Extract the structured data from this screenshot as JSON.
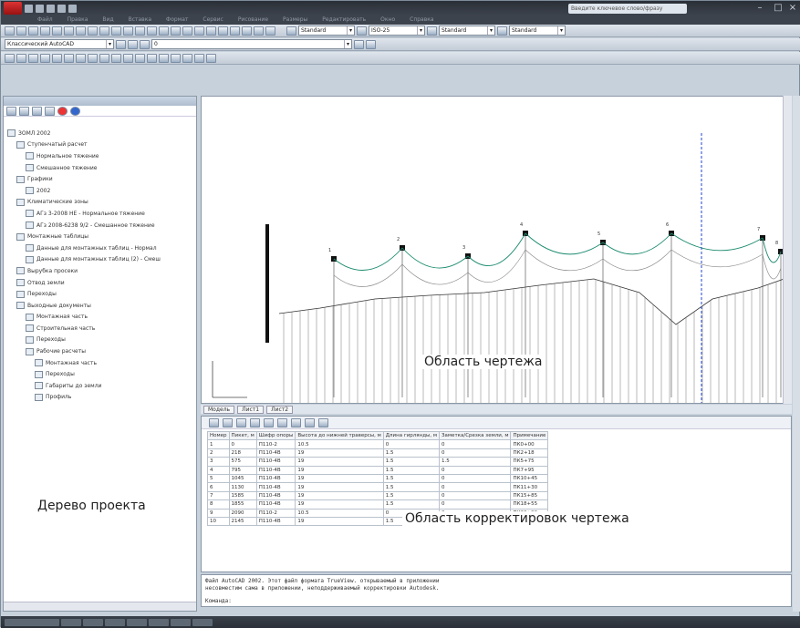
{
  "window": {
    "title": "",
    "search_placeholder": "Введите ключевое слово/фразу"
  },
  "menu": [
    "Файл",
    "Правка",
    "Вид",
    "Вставка",
    "Формат",
    "Сервис",
    "Рисование",
    "Размеры",
    "Редактировать",
    "Окно",
    "Справка"
  ],
  "toolbar": {
    "text_style": "Standard",
    "dim_style": "ISO-25",
    "table_style": "Standard",
    "mleader_style": "Standard",
    "layer": "0",
    "workspace": "Классический AutoCAD"
  },
  "left_panel": {
    "title": "",
    "tree": [
      {
        "label": "ЗОМЛ 2002",
        "level": 0
      },
      {
        "label": "Ступенчатый расчет",
        "level": 1
      },
      {
        "label": "Нормальное тяжение",
        "level": 2
      },
      {
        "label": "Смешанное тяжение",
        "level": 2
      },
      {
        "label": "Графики",
        "level": 1
      },
      {
        "label": "2002",
        "level": 2
      },
      {
        "label": "Климатические зоны",
        "level": 1
      },
      {
        "label": "АГз 3-2008 НЕ - Нормальное тяжение",
        "level": 2
      },
      {
        "label": "АГз 2008-6238 9/2 - Смешанное тяжение",
        "level": 2
      },
      {
        "label": "Монтажные таблицы",
        "level": 1
      },
      {
        "label": "Данные для монтажных таблиц - Нормал",
        "level": 2
      },
      {
        "label": "Данные для монтажных таблиц (2) - Смеш",
        "level": 2
      },
      {
        "label": "Вырубка просеки",
        "level": 1
      },
      {
        "label": "Отвод земли",
        "level": 1
      },
      {
        "label": "Переходы",
        "level": 1
      },
      {
        "label": "Выходные документы",
        "level": 1
      },
      {
        "label": "Монтажная часть",
        "level": 2
      },
      {
        "label": "Строительная часть",
        "level": 2
      },
      {
        "label": "Переходы",
        "level": 2
      },
      {
        "label": "Рабочие расчеты",
        "level": 2
      },
      {
        "label": "Монтажная часть",
        "level": 3
      },
      {
        "label": "Переходы",
        "level": 3
      },
      {
        "label": "Габариты до земли",
        "level": 3
      },
      {
        "label": "Профиль",
        "level": 3
      }
    ]
  },
  "labels": {
    "tree_area": "Дерево проекта",
    "drawing_area": "Область чертежа",
    "corrections_area": "Область корректировок чертежа"
  },
  "tabs": [
    "Модель",
    "Лист1",
    "Лист2"
  ],
  "corrections_table": {
    "headers": [
      "Номер",
      "Пикет, м",
      "Шифр опоры",
      "Высота до нижней траверсы, м",
      "Длина гирлянды, м",
      "Заметка/Срезка земли, м",
      "Примечание"
    ],
    "rows": [
      [
        "1",
        "0",
        "П110-2",
        "10.5",
        "0",
        "0",
        "ПК0+00"
      ],
      [
        "2",
        "218",
        "П110-4В",
        "19",
        "1.5",
        "0",
        "ПК2+18"
      ],
      [
        "3",
        "575",
        "П110-4В",
        "19",
        "1.5",
        "1.5",
        "ПК5+75"
      ],
      [
        "4",
        "795",
        "П110-4В",
        "19",
        "1.5",
        "0",
        "ПК7+95"
      ],
      [
        "5",
        "1045",
        "П110-4В",
        "19",
        "1.5",
        "0",
        "ПК10+45"
      ],
      [
        "6",
        "1130",
        "П110-4В",
        "19",
        "1.5",
        "0",
        "ПК11+30"
      ],
      [
        "7",
        "1585",
        "П110-4В",
        "19",
        "1.5",
        "0",
        "ПК15+85"
      ],
      [
        "8",
        "1855",
        "П110-4В",
        "19",
        "1.5",
        "0",
        "ПК18+55"
      ],
      [
        "9",
        "2090",
        "П110-2",
        "10.5",
        "0",
        "0",
        "ПК20+90"
      ],
      [
        "10",
        "2145",
        "П110-4В",
        "19",
        "1.5",
        "0",
        "ПК21+45"
      ]
    ]
  },
  "command": {
    "history_1": "Файл AutoCAD 2002. Этот файл формата TrueView. открываемый в приложении",
    "history_2": "несовместим сама в приложении, неподдерживаемый корректировки Autodesk.",
    "prompt": "Команда:"
  },
  "chart_data": {
    "type": "profile",
    "tower_labels": [
      "1",
      "2",
      "3",
      "4",
      "5",
      "6",
      "7",
      "8"
    ],
    "tower_heights": [
      19,
      19,
      19,
      19,
      19,
      19,
      19,
      19
    ]
  }
}
